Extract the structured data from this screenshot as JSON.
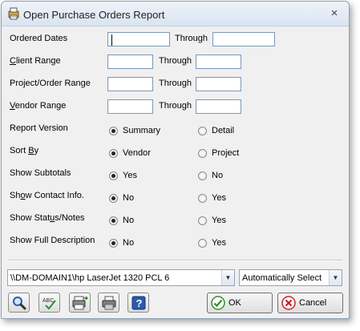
{
  "window": {
    "title": "Open Purchase Orders Report",
    "close_glyph": "×"
  },
  "rows": {
    "ordered_dates": {
      "label": "Ordered Dates",
      "through": "Through",
      "from_value": "",
      "to_value": ""
    },
    "client_range": {
      "label_first": "C",
      "label_rest": "lient Range",
      "through": "Through",
      "from_value": "",
      "to_value": ""
    },
    "project_range": {
      "label": "Project/Order Range",
      "through": "Through",
      "from_value": "",
      "to_value": ""
    },
    "vendor_range": {
      "label_first": "V",
      "label_rest": "endor Range",
      "through": "Through",
      "from_value": "",
      "to_value": ""
    }
  },
  "options": {
    "report_version": {
      "label": "Report Version",
      "a": "Summary",
      "b": "Detail",
      "selected": "a"
    },
    "sort_by": {
      "label_pre": "Sort ",
      "label_ul": "B",
      "label_post": "y",
      "a": "Vendor",
      "b": "Project",
      "selected": "a"
    },
    "show_subtotals": {
      "label": "Show Subtotals",
      "a": "Yes",
      "b": "No",
      "selected": "a"
    },
    "show_contact": {
      "label_pre": "Sh",
      "label_ul": "o",
      "label_post": "w Contact Info.",
      "a": "No",
      "b": "Yes",
      "selected": "a"
    },
    "show_status": {
      "label_pre": "Show Stat",
      "label_ul": "u",
      "label_post": "s/Notes",
      "a": "No",
      "b": "Yes",
      "selected": "a"
    },
    "show_full_desc": {
      "label": "Show Full Description",
      "a": "No",
      "b": "Yes",
      "selected": "a"
    }
  },
  "printer": {
    "value": "\\\\DM-DOMAIN1\\hp LaserJet 1320 PCL 6"
  },
  "tray": {
    "value": "Automatically Select"
  },
  "buttons": {
    "ok_label": "OK",
    "cancel_label": "Cancel"
  },
  "icons": {
    "title": "report-icon",
    "preview": "magnifier-icon",
    "spell": "spellcheck-icon",
    "export": "export-icon",
    "print": "printer-icon",
    "help": "help-icon"
  },
  "colors": {
    "ok_check": "#2f8f2f",
    "cancel_x": "#cc2222",
    "help_blue": "#2a5ab0"
  }
}
